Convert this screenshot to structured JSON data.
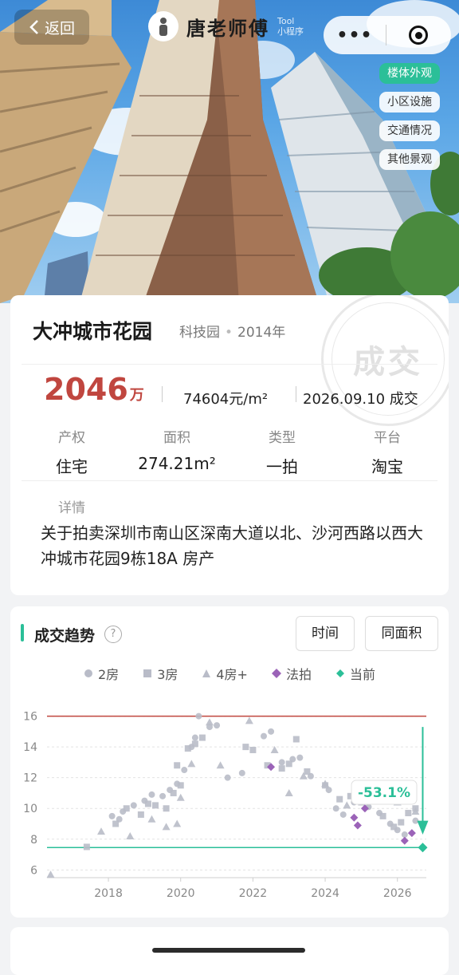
{
  "nav": {
    "back_label": "返回",
    "brand_title": "唐老师傅",
    "brand_sub_1": "Tool",
    "brand_sub_2": "小程序",
    "more_glyph": "•••"
  },
  "photo_tabs": [
    "楼体外观",
    "小区设施",
    "交通情况",
    "其他景观"
  ],
  "property": {
    "name": "大冲城市花园",
    "district": "科技园",
    "year": "2014年",
    "stamp": "成交",
    "total_price": "2046",
    "total_unit": "万",
    "unit_price": "74604元/m²",
    "deal": "2026.09.10 成交",
    "attrs": [
      {
        "k": "产权",
        "v": "住宅"
      },
      {
        "k": "面积",
        "v": "274.21m²"
      },
      {
        "k": "类型",
        "v": "一拍"
      },
      {
        "k": "平台",
        "v": "淘宝"
      }
    ],
    "detail_label": "详情",
    "detail_text": "关于拍卖深圳市南山区深南大道以北、沙河西路以西大冲城市花园9栋18A 房产"
  },
  "trend": {
    "title": "成交趋势",
    "help": "?",
    "btn_time": "时间",
    "btn_area": "同面积",
    "legend": [
      {
        "label": "2房",
        "shape": "circle",
        "color": "#b9bcc8"
      },
      {
        "label": "3房",
        "shape": "square",
        "color": "#b9bcc8"
      },
      {
        "label": "4房+",
        "shape": "triangle",
        "color": "#b9bcc8"
      },
      {
        "label": "法拍",
        "shape": "diamond",
        "color": "#9b63b8"
      },
      {
        "label": "当前",
        "shape": "diamond",
        "color": "#2bbf98"
      }
    ],
    "change_badge": "-53.1%"
  },
  "chart_data": {
    "type": "scatter",
    "title": "成交趋势",
    "xlabel": "",
    "ylabel": "",
    "xlim": [
      2016.3,
      2026.8
    ],
    "ylim": [
      5.5,
      16.6
    ],
    "x_ticks": [
      2018,
      2020,
      2022,
      2024,
      2026
    ],
    "y_ticks": [
      6,
      8,
      10,
      12,
      14,
      16
    ],
    "grid": "horizontal-dashed",
    "reference_lines": [
      {
        "name": "peak",
        "y": 16.0,
        "color": "#c0463f"
      },
      {
        "name": "current",
        "y": 7.46,
        "color": "#2bbf98"
      }
    ],
    "annotation": "-53.1%",
    "series": [
      {
        "name": "2房",
        "shape": "circle",
        "points": [
          [
            2018.1,
            9.5
          ],
          [
            2018.3,
            9.3
          ],
          [
            2018.4,
            9.8
          ],
          [
            2018.7,
            10.2
          ],
          [
            2019.0,
            10.5
          ],
          [
            2019.2,
            10.9
          ],
          [
            2019.5,
            10.8
          ],
          [
            2019.7,
            11.2
          ],
          [
            2019.9,
            11.6
          ],
          [
            2020.1,
            12.5
          ],
          [
            2020.3,
            14.0
          ],
          [
            2020.4,
            14.6
          ],
          [
            2020.5,
            16.0
          ],
          [
            2020.8,
            15.3
          ],
          [
            2021.0,
            15.4
          ],
          [
            2021.3,
            12.0
          ],
          [
            2021.7,
            12.3
          ],
          [
            2022.3,
            14.7
          ],
          [
            2022.5,
            15.0
          ],
          [
            2022.8,
            13.0
          ],
          [
            2023.1,
            13.2
          ],
          [
            2023.3,
            13.3
          ],
          [
            2023.6,
            12.1
          ],
          [
            2024.1,
            11.2
          ],
          [
            2024.3,
            10.0
          ],
          [
            2024.5,
            9.6
          ],
          [
            2024.8,
            10.4
          ],
          [
            2025.2,
            10.1
          ],
          [
            2025.5,
            9.7
          ],
          [
            2025.8,
            9.0
          ],
          [
            2026.0,
            8.6
          ],
          [
            2026.2,
            8.3
          ],
          [
            2026.5,
            9.2
          ]
        ]
      },
      {
        "name": "3房",
        "shape": "square",
        "points": [
          [
            2017.4,
            7.5
          ],
          [
            2018.2,
            9.0
          ],
          [
            2018.5,
            10.0
          ],
          [
            2018.9,
            9.6
          ],
          [
            2019.1,
            10.3
          ],
          [
            2019.3,
            10.2
          ],
          [
            2019.6,
            10.0
          ],
          [
            2019.8,
            11.0
          ],
          [
            2019.9,
            12.8
          ],
          [
            2020.0,
            11.5
          ],
          [
            2020.2,
            13.9
          ],
          [
            2020.4,
            14.2
          ],
          [
            2020.6,
            14.6
          ],
          [
            2021.8,
            14.0
          ],
          [
            2022.0,
            13.8
          ],
          [
            2022.4,
            12.8
          ],
          [
            2022.8,
            12.6
          ],
          [
            2023.0,
            12.9
          ],
          [
            2023.2,
            14.5
          ],
          [
            2023.5,
            12.4
          ],
          [
            2024.0,
            11.5
          ],
          [
            2024.4,
            10.6
          ],
          [
            2024.7,
            10.8
          ],
          [
            2025.0,
            10.4
          ],
          [
            2025.3,
            10.7
          ],
          [
            2025.6,
            9.5
          ],
          [
            2025.9,
            8.8
          ],
          [
            2026.1,
            9.1
          ],
          [
            2026.3,
            9.7
          ],
          [
            2026.5,
            10.0
          ]
        ]
      },
      {
        "name": "4房+",
        "shape": "triangle",
        "points": [
          [
            2016.4,
            5.7
          ],
          [
            2017.8,
            8.5
          ],
          [
            2018.6,
            8.2
          ],
          [
            2019.2,
            9.3
          ],
          [
            2019.6,
            8.8
          ],
          [
            2019.9,
            9.0
          ],
          [
            2020.0,
            10.7
          ],
          [
            2020.3,
            12.9
          ],
          [
            2020.8,
            15.6
          ],
          [
            2021.1,
            12.8
          ],
          [
            2021.9,
            15.7
          ],
          [
            2022.6,
            13.8
          ],
          [
            2023.0,
            11.0
          ],
          [
            2023.4,
            12.1
          ],
          [
            2024.0,
            11.6
          ],
          [
            2024.6,
            10.2
          ],
          [
            2025.3,
            11.3
          ],
          [
            2025.6,
            11.0
          ],
          [
            2026.0,
            10.4
          ],
          [
            2026.5,
            9.8
          ]
        ]
      },
      {
        "name": "法拍",
        "shape": "diamond",
        "points": [
          [
            2022.5,
            12.7
          ],
          [
            2024.8,
            9.4
          ],
          [
            2024.9,
            8.9
          ],
          [
            2025.1,
            10.0
          ],
          [
            2026.2,
            7.9
          ],
          [
            2026.4,
            8.4
          ]
        ]
      },
      {
        "name": "当前",
        "shape": "diamond",
        "points": [
          [
            2026.7,
            7.46
          ]
        ]
      }
    ]
  }
}
